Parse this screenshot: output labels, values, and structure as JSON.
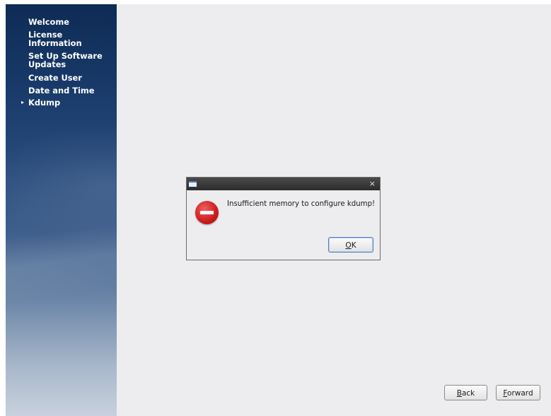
{
  "sidebar": {
    "steps": [
      {
        "label": "Welcome"
      },
      {
        "label": "License Information"
      },
      {
        "label": "Set Up Software Updates"
      },
      {
        "label": "Create User"
      },
      {
        "label": "Date and Time"
      },
      {
        "label": "Kdump",
        "current": true
      }
    ],
    "current_marker": "▸"
  },
  "dialog": {
    "close_glyph": "×",
    "icon": "error-icon",
    "message": "Insufficient memory to configure kdump!",
    "ok": {
      "mnemonic": "O",
      "rest": "K"
    }
  },
  "footer": {
    "back": {
      "mnemonic": "B",
      "rest": "ack"
    },
    "forward": {
      "mnemonic": "F",
      "rest": "orward"
    }
  },
  "colors": {
    "sidebar_top": "#0e2b54",
    "sidebar_bottom": "#c8d1dd",
    "content_bg": "#ededef",
    "error_red": "#cc1a1a",
    "default_button_border": "#4f7fbf"
  }
}
